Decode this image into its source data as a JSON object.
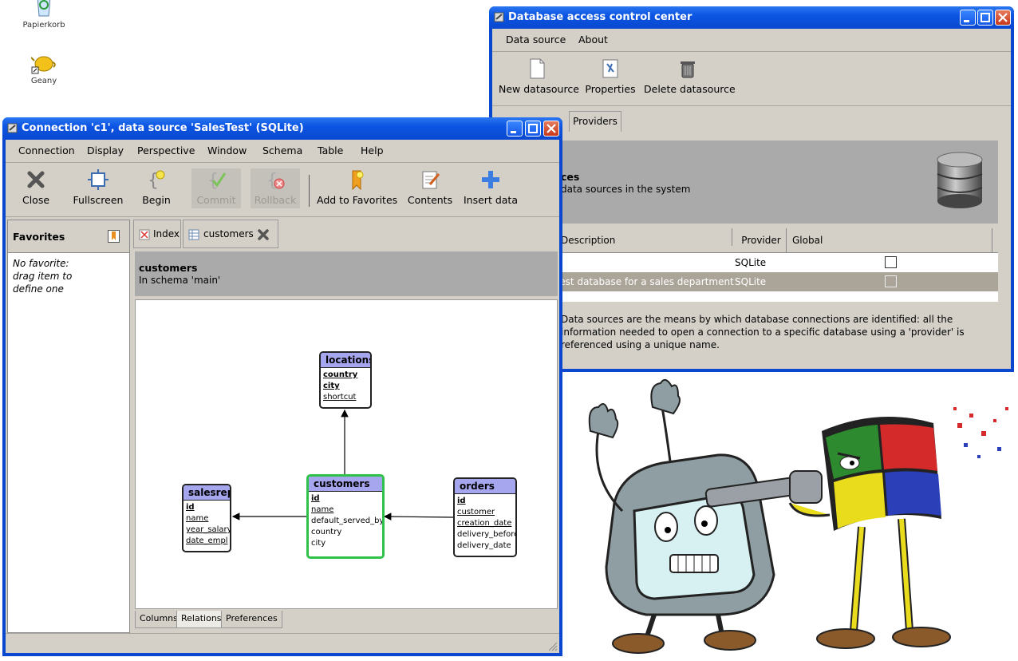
{
  "desktop": {
    "icons": [
      {
        "label": "Papierkorb",
        "icon": "recycle-bin-icon"
      },
      {
        "label": "Geany",
        "icon": "geany-teapot-icon"
      }
    ]
  },
  "dacc": {
    "title": "Database access control center",
    "menu": [
      "Data source",
      "About"
    ],
    "toolbar": [
      {
        "label": "New datasource",
        "icon": "new-document-icon"
      },
      {
        "label": "Properties",
        "icon": "properties-icon"
      },
      {
        "label": "Delete datasource",
        "icon": "trash-can-icon"
      }
    ],
    "tabs": [
      "Providers"
    ],
    "header": {
      "title": "ces",
      "subtitle": "data sources in the system"
    },
    "columns": [
      "Description",
      "Provider",
      "Global"
    ],
    "rows": [
      {
        "description": "",
        "provider": "SQLite",
        "global": false
      },
      {
        "description": "Test database for a sales department",
        "provider": "SQLite",
        "global": false
      }
    ],
    "note": "Data sources are the means by which database connections are identified: all the information needed to open a connection to a specific database using a 'provider' is referenced using a unique name."
  },
  "conn": {
    "title": "Connection 'c1', data source 'SalesTest' (SQLite)",
    "menu": [
      "Connection",
      "Display",
      "Perspective",
      "Window",
      "Schema",
      "Table",
      "Help"
    ],
    "toolbar": [
      {
        "label": "Close",
        "icon": "close-x-icon",
        "enabled": true
      },
      {
        "label": "Fullscreen",
        "icon": "fullscreen-icon",
        "enabled": true
      },
      {
        "label": "Begin",
        "icon": "begin-transaction-icon",
        "enabled": true
      },
      {
        "label": "Commit",
        "icon": "commit-icon",
        "enabled": false
      },
      {
        "label": "Rollback",
        "icon": "rollback-icon",
        "enabled": false
      },
      {
        "label": "Add to Favorites",
        "icon": "add-favorite-icon",
        "enabled": true
      },
      {
        "label": "Contents",
        "icon": "contents-icon",
        "enabled": true
      },
      {
        "label": "Insert data",
        "icon": "insert-plus-icon",
        "enabled": true
      }
    ],
    "favorites": {
      "title": "Favorites",
      "empty_lines": [
        "No favorite:",
        "drag item to",
        "define one"
      ]
    },
    "tabs": [
      {
        "label": "Index",
        "icon": "index-icon"
      },
      {
        "label": "customers",
        "icon": "table-icon"
      }
    ],
    "object": {
      "name": "customers",
      "schema": "In schema 'main'"
    },
    "bottom_tabs": [
      "Columns",
      "Relations",
      "Preferences"
    ],
    "diagram": {
      "tables": {
        "locations": {
          "name": "locations",
          "fields": [
            "country",
            "city",
            "shortcut"
          ]
        },
        "salesrep": {
          "name": "salesrep",
          "fields": [
            "id",
            "name",
            "year_salary",
            "date_empl"
          ]
        },
        "customers": {
          "name": "customers",
          "fields": [
            "id",
            "name",
            "default_served_by",
            "country",
            "city"
          ]
        },
        "orders": {
          "name": "orders",
          "fields": [
            "id",
            "customer",
            "creation_date",
            "delivery_before",
            "delivery_date"
          ]
        }
      }
    }
  }
}
